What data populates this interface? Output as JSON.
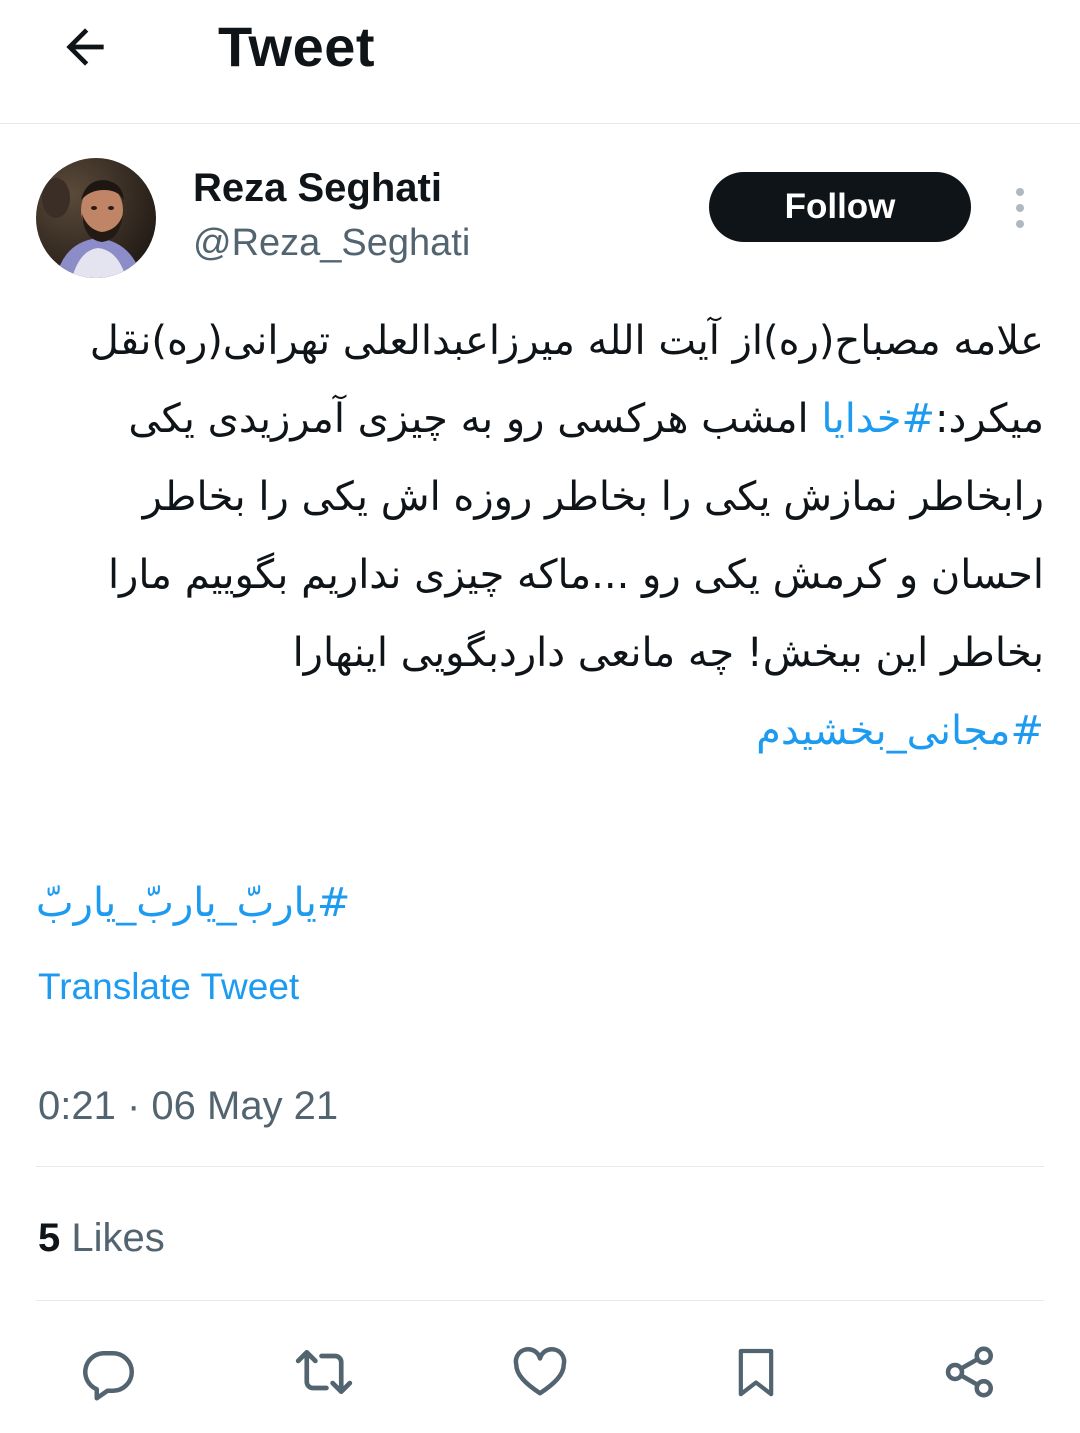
{
  "header": {
    "title": "Tweet",
    "back_icon": "arrow-left-icon"
  },
  "tweet": {
    "author": {
      "name": "Reza Seghati",
      "handle": "@Reza_Seghati",
      "avatar": "user-avatar-photo"
    },
    "follow_label": "Follow",
    "more_icon": "more-vertical-icon",
    "text_part1": "علامه مصباح(ره)از آیت الله میرزاعبدالعلی تهرانی(ره)نقل میکرد:",
    "hashtag_1": "#خدایا",
    "text_part2": " امشب هرکسی رو به چیزی آمرزیدی یکی رابخاطر نمازش یکی را بخاطر روزه اش یکی را بخاطر احسان و کرمش یکی رو ...ماکه چیزی نداریم بگوییم مارا بخاطر این ببخش! چه مانعی داردبگویی اینهارا ",
    "hashtag_2": "#مجانی_بخشیدم",
    "hashtag_3": "#یاربّ_یاربّ_یاربّ",
    "translate_label": "Translate Tweet",
    "timestamp": "0:21 · 06 May 21",
    "likes_count": "5",
    "likes_label": "Likes"
  },
  "actions": {
    "reply_icon": "reply-icon",
    "retweet_icon": "retweet-icon",
    "like_icon": "heart-icon",
    "bookmark_icon": "bookmark-icon",
    "share_icon": "share-icon"
  },
  "colors": {
    "accent": "#1d9bf0",
    "text_primary": "#0f1419",
    "text_secondary": "#536471",
    "divider": "#e7e9ea",
    "follow_bg": "#0f1419"
  }
}
